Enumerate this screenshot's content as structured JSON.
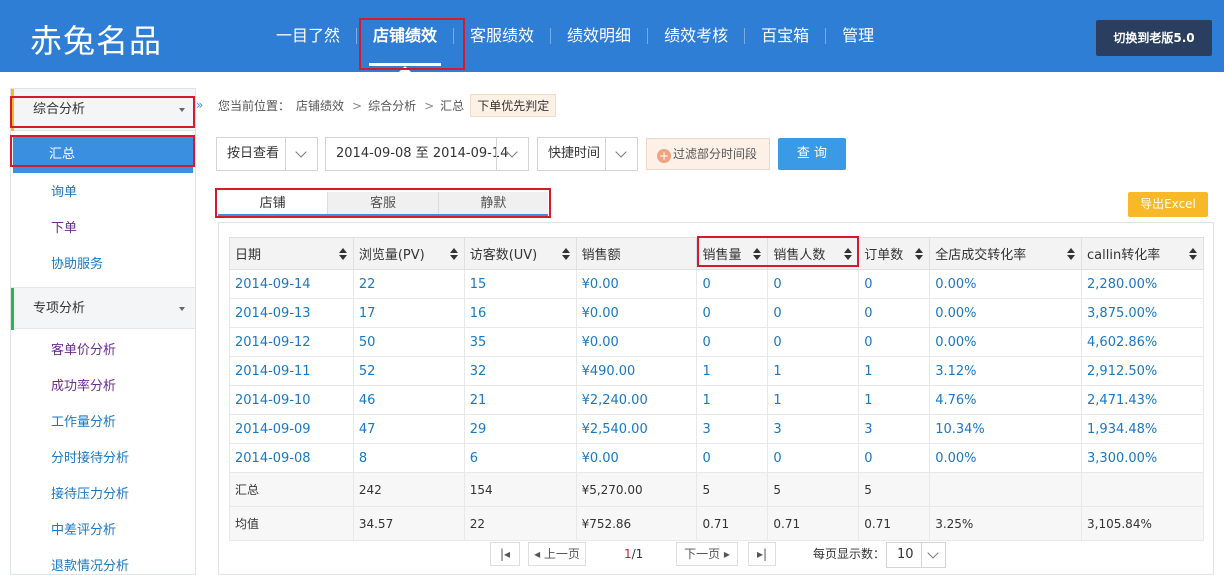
{
  "header": {
    "logo": "赤兔名品",
    "nav": [
      "一目了然",
      "店铺绩效",
      "客服绩效",
      "绩效明细",
      "绩效考核",
      "百宝箱",
      "管理"
    ],
    "active_nav": "店铺绩效",
    "switch_label": "切换到老版5.0"
  },
  "sidebar": {
    "group1": {
      "label": "综合分析",
      "accent": "#f7b928"
    },
    "group1_items": [
      "汇总",
      "询单",
      "下单",
      "协助服务"
    ],
    "group2": {
      "label": "专项分析",
      "accent": "#2eb34a"
    },
    "group2_items": [
      "客单价分析",
      "成功率分析",
      "工作量分析",
      "分时接待分析",
      "接待压力分析",
      "中差评分析",
      "退款情况分析"
    ],
    "collapse_icon": "»"
  },
  "breadcrumb": {
    "prefix": "您当前位置：",
    "items": [
      "店铺绩效",
      "综合分析",
      "汇总"
    ],
    "tag": "下单优先判定"
  },
  "filters": {
    "view_by": "按日查看",
    "date_range": "2014-09-08 至 2014-09-14",
    "quick_time": "快捷时间",
    "filter_period": "过滤部分时间段",
    "query": "查 询"
  },
  "tabs": [
    "店铺",
    "客服",
    "静默"
  ],
  "active_tab": "店铺",
  "export_label": "导出Excel",
  "table": {
    "headers": [
      "日期",
      "浏览量(PV)",
      "访客数(UV)",
      "销售额",
      "销售量",
      "销售人数",
      "订单数",
      "全店成交转化率",
      "callin转化率"
    ],
    "rows": [
      [
        "2014-09-14",
        "22",
        "15",
        "¥0.00",
        "0",
        "0",
        "0",
        "0.00%",
        "2,280.00%"
      ],
      [
        "2014-09-13",
        "17",
        "16",
        "¥0.00",
        "0",
        "0",
        "0",
        "0.00%",
        "3,875.00%"
      ],
      [
        "2014-09-12",
        "50",
        "35",
        "¥0.00",
        "0",
        "0",
        "0",
        "0.00%",
        "4,602.86%"
      ],
      [
        "2014-09-11",
        "52",
        "32",
        "¥490.00",
        "1",
        "1",
        "1",
        "3.12%",
        "2,912.50%"
      ],
      [
        "2014-09-10",
        "46",
        "21",
        "¥2,240.00",
        "1",
        "1",
        "1",
        "4.76%",
        "2,471.43%"
      ],
      [
        "2014-09-09",
        "47",
        "29",
        "¥2,540.00",
        "3",
        "3",
        "3",
        "10.34%",
        "1,934.48%"
      ],
      [
        "2014-09-08",
        "8",
        "6",
        "¥0.00",
        "0",
        "0",
        "0",
        "0.00%",
        "3,300.00%"
      ]
    ],
    "sum": [
      "汇总",
      "242",
      "154",
      "¥5,270.00",
      "5",
      "5",
      "5",
      "",
      ""
    ],
    "avg": [
      "均值",
      "34.57",
      "22",
      "¥752.86",
      "0.71",
      "0.71",
      "0.71",
      "3.25%",
      "3,105.84%"
    ]
  },
  "pager": {
    "first": "|◂",
    "prev": "◂ 上一页",
    "current": "1",
    "total": "/1",
    "next": "下一页 ▸",
    "last": "▸|",
    "per_page_label": "每页显示数：",
    "per_page": "10"
  }
}
